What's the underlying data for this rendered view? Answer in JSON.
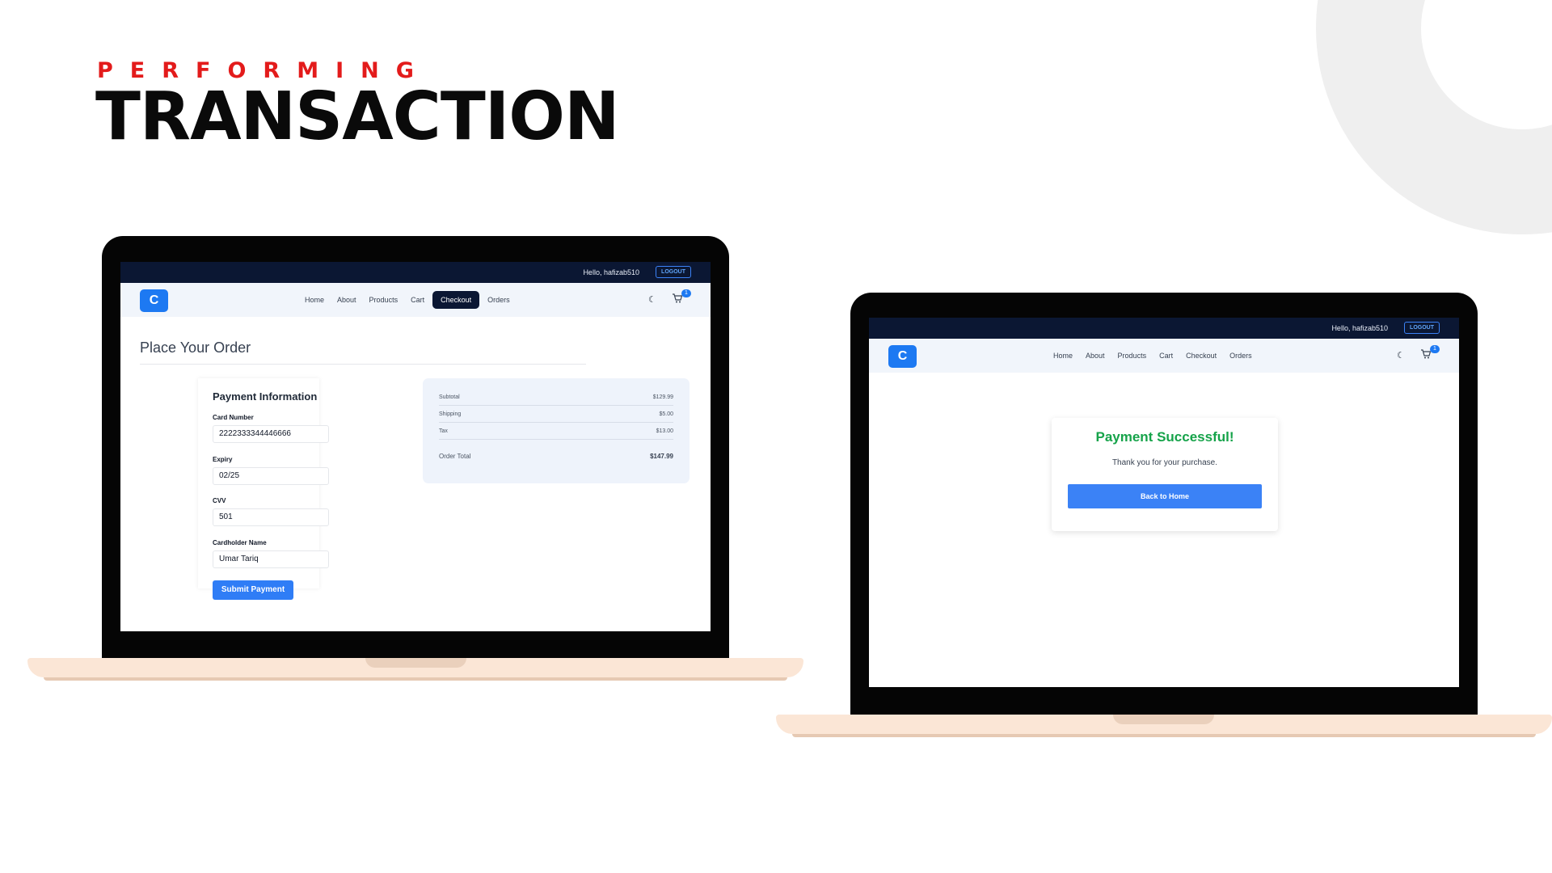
{
  "slide": {
    "kicker": "PERFORMING",
    "headline": "TRANSACTION"
  },
  "app": {
    "logo_letter": "C",
    "greeting": "Hello, hafizab510",
    "logout_label": "LOGOUT",
    "nav": [
      "Home",
      "About",
      "Products",
      "Cart",
      "Checkout",
      "Orders"
    ],
    "cart_count": "1",
    "moon_glyph": "☾",
    "cart_glyph": "🛒"
  },
  "checkout_screen": {
    "page_title": "Place Your Order",
    "active_nav": "Checkout",
    "payment": {
      "title": "Payment Information",
      "card_number_label": "Card Number",
      "card_number_value": "2222333344446666",
      "expiry_label": "Expiry",
      "expiry_value": "02/25",
      "cvv_label": "CVV",
      "cvv_value": "501",
      "name_label": "Cardholder Name",
      "name_value": "Umar Tariq",
      "submit_label": "Submit Payment"
    },
    "summary": {
      "subtotal_label": "Subtotal",
      "subtotal_value": "$129.99",
      "shipping_label": "Shipping",
      "shipping_value": "$5.00",
      "tax_label": "Tax",
      "tax_value": "$13.00",
      "total_label": "Order Total",
      "total_value": "$147.99"
    }
  },
  "success_screen": {
    "title": "Payment Successful!",
    "message": "Thank you for your purchase.",
    "button_label": "Back to Home"
  }
}
